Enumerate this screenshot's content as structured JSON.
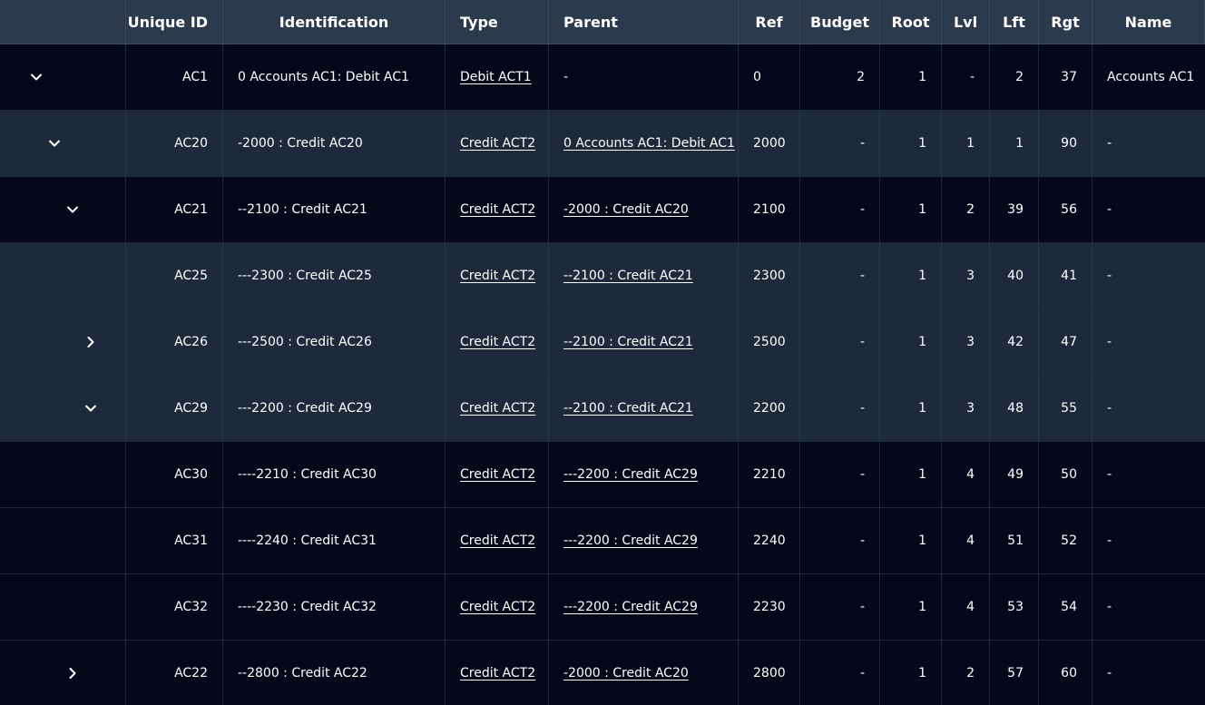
{
  "columns": {
    "toggle": "",
    "unique_id": "Unique ID",
    "identification": "Identification",
    "type": "Type",
    "parent": "Parent",
    "ref": "Ref",
    "budget": "Budget",
    "root": "Root",
    "lvl": "Lvl",
    "lft": "Lft",
    "rgt": "Rgt",
    "name": "Name"
  },
  "rows": [
    {
      "toggle": "expanded",
      "depth": 0,
      "tone": "dark",
      "unique_id": "AC1",
      "identification": "0 Accounts AC1: Debit AC1",
      "type": "Debit ACT1",
      "parent": "-",
      "parent_link": false,
      "ref": "0",
      "budget": "2",
      "root": "1",
      "lvl": "-",
      "lft": "2",
      "rgt": "37",
      "name": "Accounts AC1"
    },
    {
      "toggle": "expanded",
      "depth": 1,
      "tone": "mid",
      "unique_id": "AC20",
      "identification": "-2000 : Credit AC20",
      "type": "Credit ACT2",
      "parent": "0 Accounts AC1: Debit AC1",
      "parent_link": true,
      "ref": "2000",
      "budget": "-",
      "root": "1",
      "lvl": "1",
      "lft": "1",
      "rgt": "90",
      "name": "-"
    },
    {
      "toggle": "expanded",
      "depth": 2,
      "tone": "dark",
      "unique_id": "AC21",
      "identification": "--2100 : Credit AC21",
      "type": "Credit ACT2",
      "parent": "-2000 : Credit AC20",
      "parent_link": true,
      "ref": "2100",
      "budget": "-",
      "root": "1",
      "lvl": "2",
      "lft": "39",
      "rgt": "56",
      "name": "-"
    },
    {
      "toggle": "none",
      "depth": 3,
      "tone": "mid",
      "unique_id": "AC25",
      "identification": "---2300 : Credit AC25",
      "type": "Credit ACT2",
      "parent": "--2100 : Credit AC21",
      "parent_link": true,
      "ref": "2300",
      "budget": "-",
      "root": "1",
      "lvl": "3",
      "lft": "40",
      "rgt": "41",
      "name": "-"
    },
    {
      "toggle": "collapsed",
      "depth": 3,
      "tone": "mid",
      "unique_id": "AC26",
      "identification": "---2500 : Credit AC26",
      "type": "Credit ACT2",
      "parent": "--2100 : Credit AC21",
      "parent_link": true,
      "ref": "2500",
      "budget": "-",
      "root": "1",
      "lvl": "3",
      "lft": "42",
      "rgt": "47",
      "name": "-"
    },
    {
      "toggle": "expanded",
      "depth": 3,
      "tone": "mid",
      "unique_id": "AC29",
      "identification": "---2200 : Credit AC29",
      "type": "Credit ACT2",
      "parent": "--2100 : Credit AC21",
      "parent_link": true,
      "ref": "2200",
      "budget": "-",
      "root": "1",
      "lvl": "3",
      "lft": "48",
      "rgt": "55",
      "name": "-"
    },
    {
      "toggle": "none",
      "depth": 4,
      "tone": "dark",
      "unique_id": "AC30",
      "identification": "----2210 : Credit AC30",
      "type": "Credit ACT2",
      "parent": "---2200 : Credit AC29",
      "parent_link": true,
      "ref": "2210",
      "budget": "-",
      "root": "1",
      "lvl": "4",
      "lft": "49",
      "rgt": "50",
      "name": "-"
    },
    {
      "toggle": "none",
      "depth": 4,
      "tone": "dark",
      "unique_id": "AC31",
      "identification": "----2240 : Credit AC31",
      "type": "Credit ACT2",
      "parent": "---2200 : Credit AC29",
      "parent_link": true,
      "ref": "2240",
      "budget": "-",
      "root": "1",
      "lvl": "4",
      "lft": "51",
      "rgt": "52",
      "name": "-"
    },
    {
      "toggle": "none",
      "depth": 4,
      "tone": "dark",
      "unique_id": "AC32",
      "identification": "----2230 : Credit AC32",
      "type": "Credit ACT2",
      "parent": "---2200 : Credit AC29",
      "parent_link": true,
      "ref": "2230",
      "budget": "-",
      "root": "1",
      "lvl": "4",
      "lft": "53",
      "rgt": "54",
      "name": "-"
    },
    {
      "toggle": "collapsed",
      "depth": 2,
      "tone": "dark",
      "unique_id": "AC22",
      "identification": "--2800 : Credit AC22",
      "type": "Credit ACT2",
      "parent": "-2000 : Credit AC20",
      "parent_link": true,
      "ref": "2800",
      "budget": "-",
      "root": "1",
      "lvl": "2",
      "lft": "57",
      "rgt": "60",
      "name": "-"
    }
  ],
  "icons": {
    "expanded": "chevron-down-icon",
    "collapsed": "chevron-right-icon"
  },
  "colors": {
    "header_bg": "#2c3a4d",
    "row_dark": "#05081a",
    "row_mid": "#1e2a3c",
    "text": "#ffffff"
  }
}
